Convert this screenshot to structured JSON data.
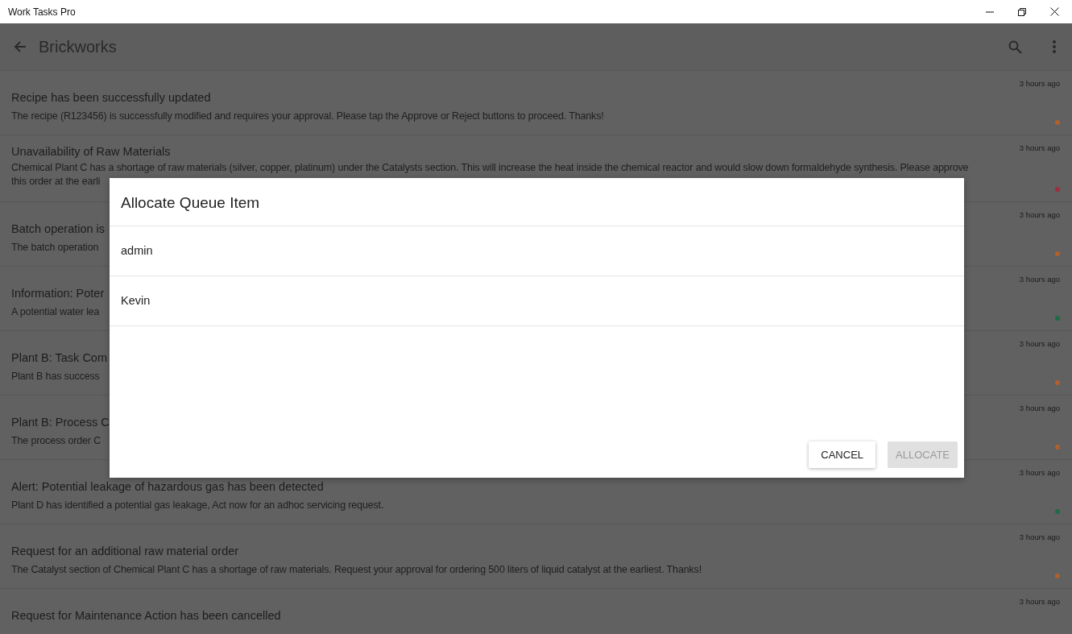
{
  "window": {
    "title": "Work Tasks Pro"
  },
  "app_bar": {
    "title": "Brickworks"
  },
  "notifications": [
    {
      "title": "Recipe has been successfully updated",
      "description": [
        "The recipe (R123456) is successfully modified and requires your approval. Please tap the Approve or Reject buttons to proceed. Thanks!"
      ],
      "time": "3 hours ago",
      "color": "#b0602c"
    },
    {
      "title": "Unavailability of Raw Materials",
      "description": [
        "Chemical Plant C has a shortage of raw materials (silver, copper, platinum) under the Catalysts section. This will increase the heat inside the chemical reactor and would slow down formaldehyde synthesis. Please approve",
        "this order at the earli"
      ],
      "time": "3 hours ago",
      "color": "#9e2f3e"
    },
    {
      "title": "Batch operation is",
      "description": [
        "The batch operation"
      ],
      "time": "3 hours ago",
      "color": "#b0602c"
    },
    {
      "title": "Information: Poter",
      "description": [
        "A potential water lea"
      ],
      "time": "3 hours ago",
      "color": "#1e6b47"
    },
    {
      "title": "Plant B: Task Com",
      "description": [
        "Plant B has success"
      ],
      "time": "3 hours ago",
      "color": "#b0602c"
    },
    {
      "title": "Plant B: Process C",
      "description": [
        "The process order C"
      ],
      "time": "3 hours ago",
      "color": "#b0602c"
    },
    {
      "title": "Alert: Potential leakage of hazardous gas has been detected",
      "description": [
        "Plant D has identified a potential gas leakage, Act now for an adhoc servicing request."
      ],
      "time": "3 hours ago",
      "color": "#1e6b47"
    },
    {
      "title": "Request for an additional raw material order",
      "description": [
        "The Catalyst section of Chemical Plant C has a shortage of raw materials. Request your approval for ordering 500 liters of liquid catalyst at the earliest. Thanks!"
      ],
      "time": "3 hours ago",
      "color": "#b0602c"
    },
    {
      "title": "Request for Maintenance Action has been cancelled",
      "time": "3 hours ago"
    }
  ],
  "dialog": {
    "title": "Allocate Queue Item",
    "options": [
      "admin",
      "Kevin"
    ],
    "buttons": [
      {
        "label": "CANCEL",
        "disabled": false
      },
      {
        "label": "ALLOCATE",
        "disabled": true
      }
    ]
  }
}
